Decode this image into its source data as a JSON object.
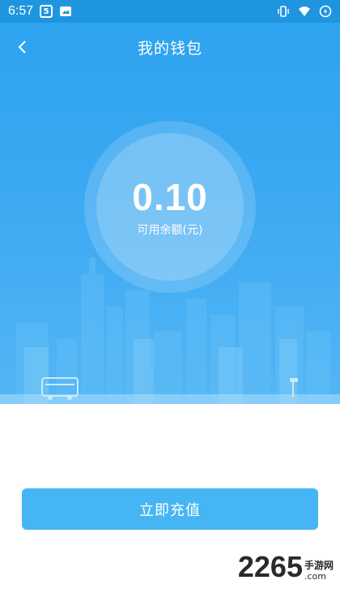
{
  "status_bar": {
    "time": "6:57",
    "app_icon_1": "5",
    "icons": [
      "vibrate-icon",
      "wifi-icon",
      "battery-icon"
    ]
  },
  "header": {
    "title": "我的钱包",
    "back_icon": "chevron-left-icon"
  },
  "balance": {
    "amount": "0.10",
    "label": "可用余额(元)"
  },
  "actions": {
    "recharge_label": "立即充值"
  },
  "watermark": {
    "number": "2265",
    "suffix_cn": "手游网",
    "domain": ".com"
  },
  "colors": {
    "primary": "#2ea3f0",
    "button": "#45b6f3",
    "statusbar": "#1f95df"
  }
}
